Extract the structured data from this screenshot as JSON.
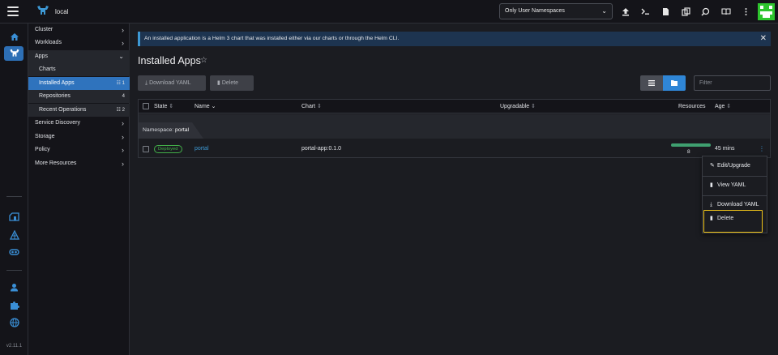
{
  "topbar": {
    "cluster_name": "local",
    "namespace_select": "Only User Namespaces",
    "icons": [
      "upload-icon",
      "terminal-icon",
      "file-icon",
      "copy-icon",
      "search-icon",
      "book-icon",
      "more-icon"
    ]
  },
  "rail": {
    "version": "v2.11.1",
    "icons": [
      "home-icon",
      "cluster-icon",
      "store-icon",
      "fleet-icon",
      "extensions-icon",
      "user-icon",
      "puzzle-icon",
      "globe-icon"
    ]
  },
  "sidenav": {
    "cluster": "Cluster",
    "workloads": "Workloads",
    "apps": "Apps",
    "apps_children": [
      {
        "label": "Charts",
        "count": ""
      },
      {
        "label": "Installed Apps",
        "count": "1"
      },
      {
        "label": "Repositories",
        "count": "4"
      },
      {
        "label": "Recent Operations",
        "count": "2"
      }
    ],
    "service_discovery": "Service Discovery",
    "storage": "Storage",
    "policy": "Policy",
    "more_resources": "More Resources"
  },
  "main": {
    "banner": "An installed application is a Helm 3 chart that was installed either via our charts or through the Helm CLI.",
    "title": "Installed Apps",
    "download_yaml": "Download YAML",
    "delete": "Delete",
    "filter_placeholder": "Filter"
  },
  "table": {
    "headers": {
      "state": "State",
      "name": "Name",
      "chart": "Chart",
      "upgradable": "Upgradable",
      "resources": "Resources",
      "age": "Age"
    },
    "namespace_label": "Namespace:",
    "namespace_value": "portal",
    "rows": [
      {
        "state": "Deployed",
        "name": "portal",
        "chart": "portal-app:0.1.0",
        "upgradable": "",
        "resources": "8",
        "age": "45 mins"
      }
    ]
  },
  "context_menu": {
    "items": [
      "Edit/Upgrade",
      "View YAML",
      "Download YAML",
      "Delete"
    ],
    "highlighted": "Delete"
  },
  "colors": {
    "accent": "#3d98d3",
    "active_nav": "#2f73bd",
    "deployed": "#43b049",
    "highlight": "#f0c419"
  }
}
